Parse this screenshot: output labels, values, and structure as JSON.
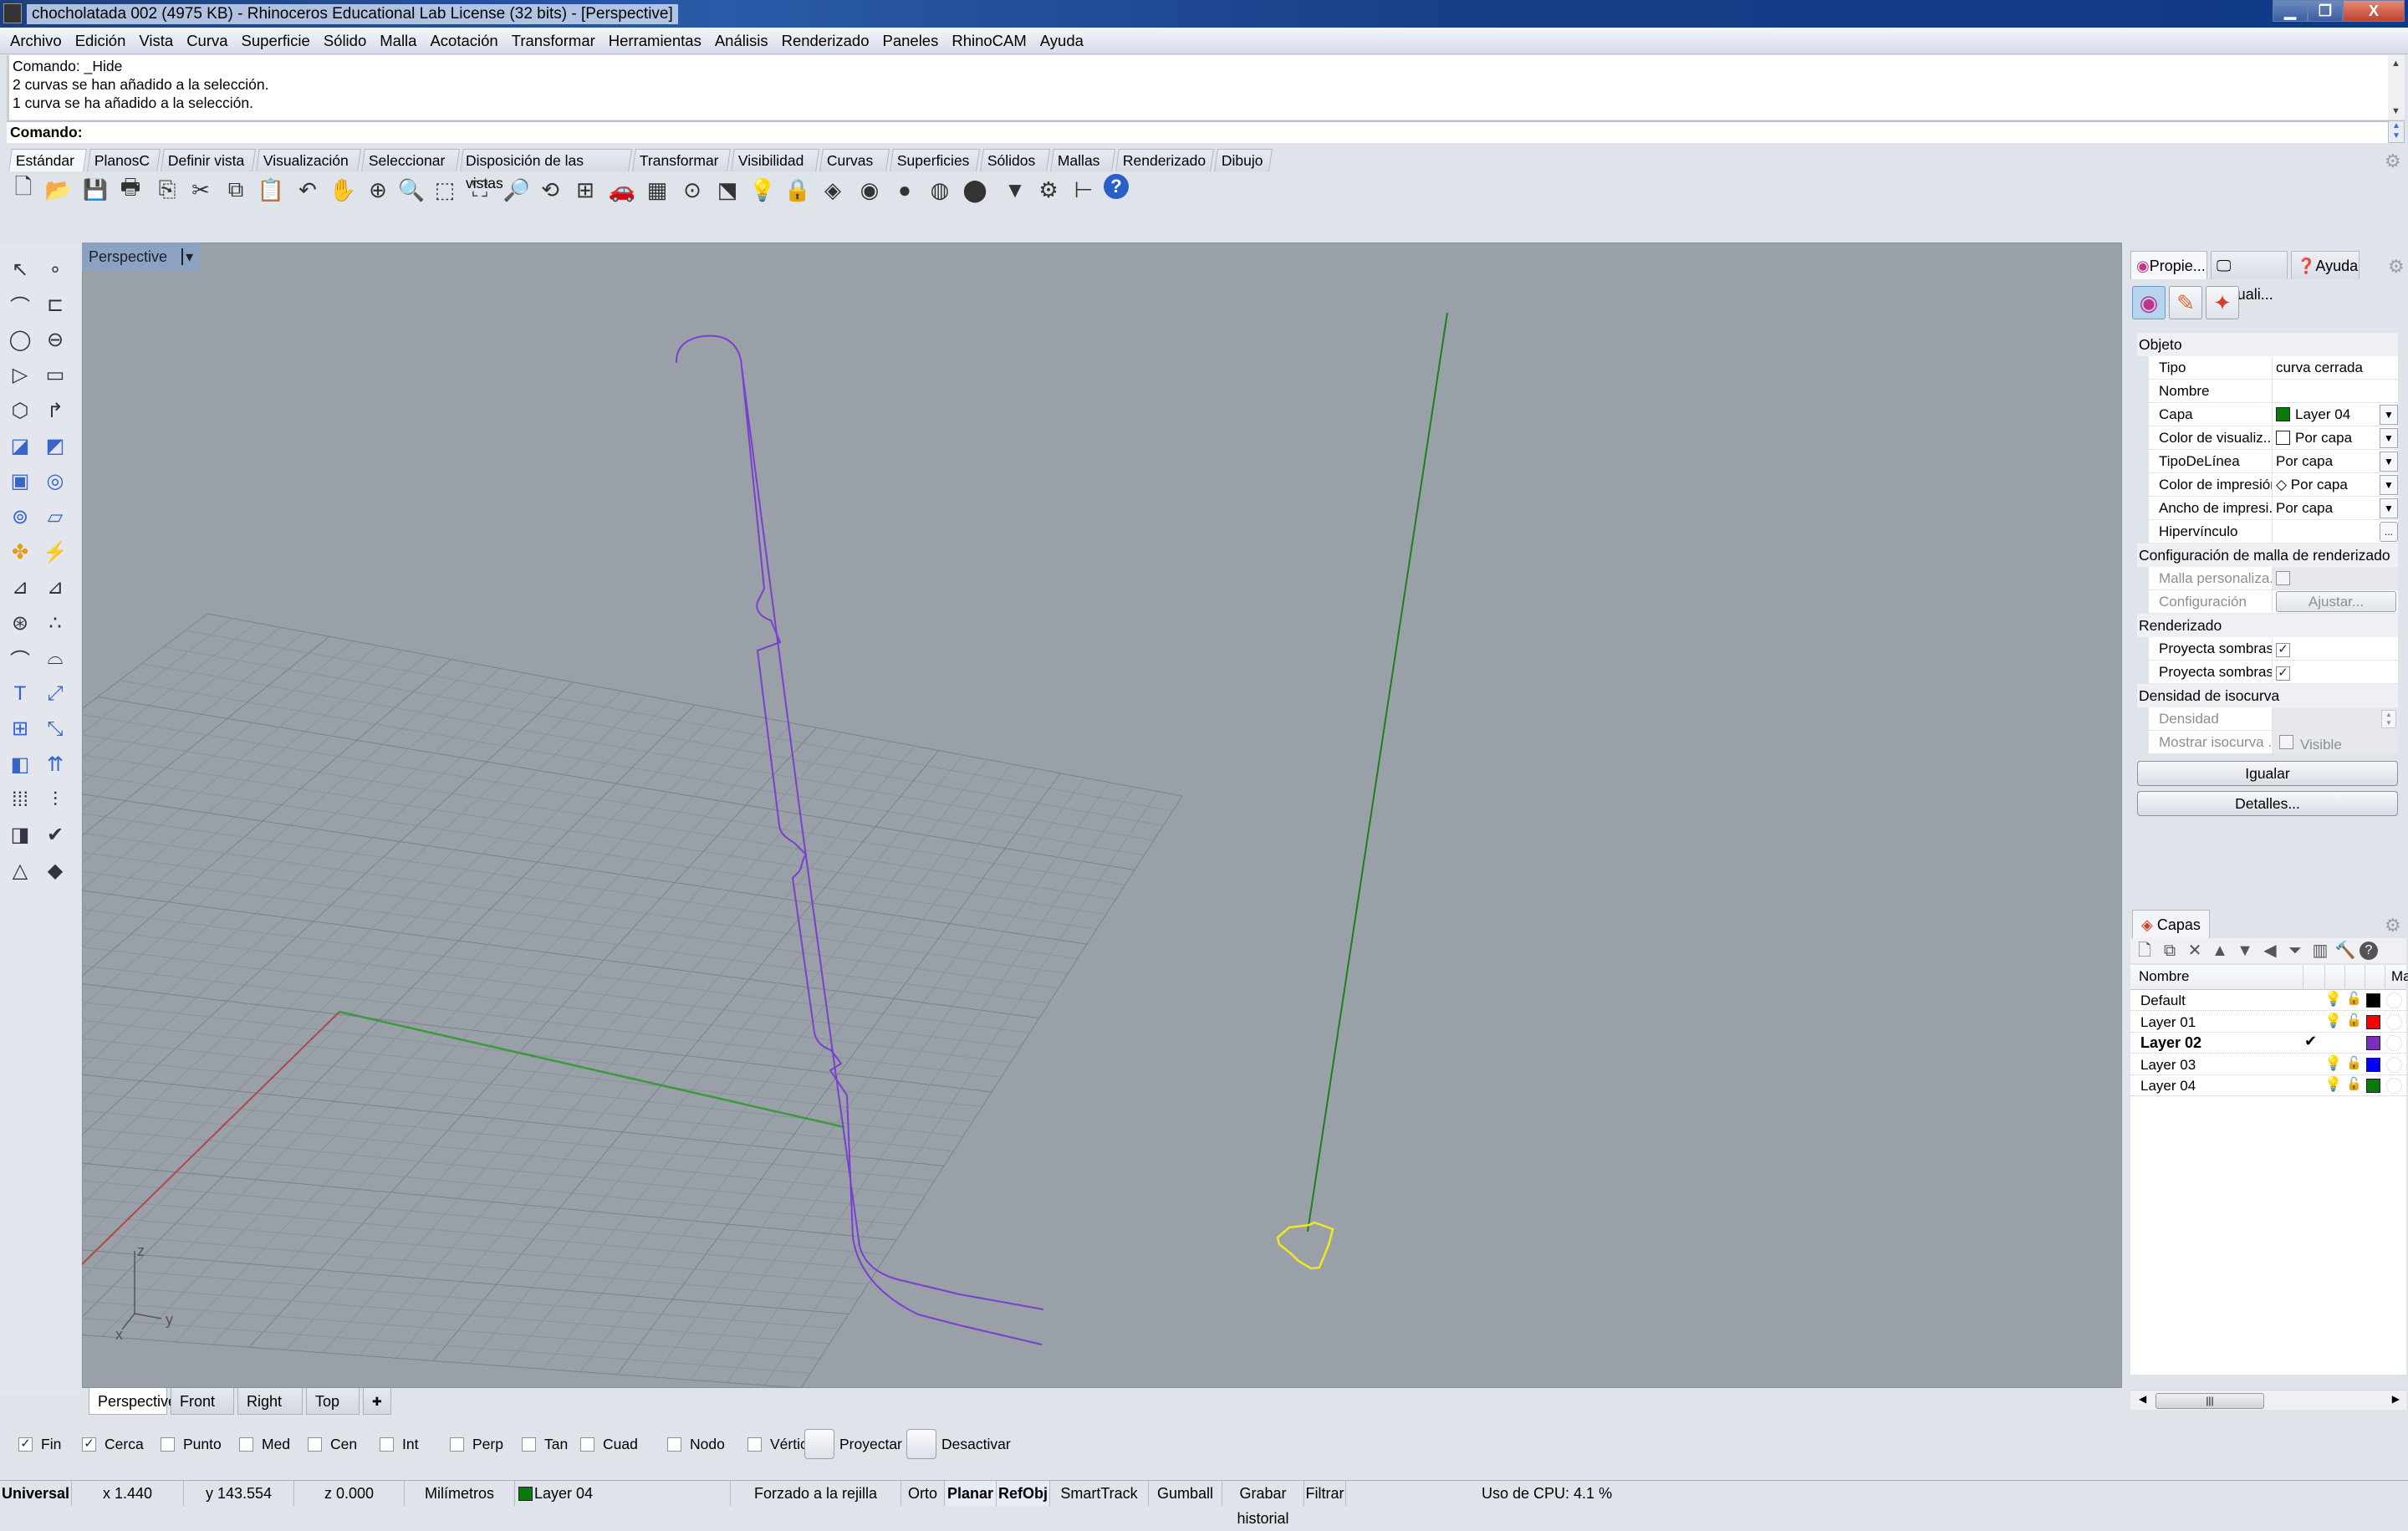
{
  "window": {
    "title": "chocholatada 002 (4975 KB) - Rhinoceros Educational Lab License (32 bits) - [Perspective]",
    "controls": {
      "minimize": "▁",
      "maximize": "❐",
      "close": "X"
    }
  },
  "menu": [
    "Archivo",
    "Edición",
    "Vista",
    "Curva",
    "Superficie",
    "Sólido",
    "Malla",
    "Acotación",
    "Transformar",
    "Herramientas",
    "Análisis",
    "Renderizado",
    "Paneles",
    "RhinoCAM",
    "Ayuda"
  ],
  "command": {
    "history": [
      "Comando: _Hide",
      "2 curvas se han añadido a la selección.",
      "1 curva se ha añadido a la selección."
    ],
    "prompt": "Comando:",
    "value": ""
  },
  "toolbar_tabs": [
    "Estándar",
    "PlanosC",
    "Definir vista",
    "Visualización",
    "Seleccionar",
    "Disposición de las vistas",
    "Transformar",
    "Visibilidad",
    "Curvas",
    "Superficies",
    "Sólidos",
    "Mallas",
    "Renderizado",
    "Dibujo"
  ],
  "toolbar_active_tab": "Estándar",
  "toolbar_icons": [
    {
      "name": "new-file-icon",
      "glyph": "🗋"
    },
    {
      "name": "open-folder-icon",
      "glyph": "📂"
    },
    {
      "name": "save-icon",
      "glyph": "💾"
    },
    {
      "name": "print-icon",
      "glyph": "🖶"
    },
    {
      "name": "export-icon",
      "glyph": "⎘"
    },
    {
      "name": "cut-icon",
      "glyph": "✂"
    },
    {
      "name": "copy-icon",
      "glyph": "⧉"
    },
    {
      "name": "paste-icon",
      "glyph": "📋"
    },
    {
      "name": "undo-icon",
      "glyph": "↶"
    },
    {
      "name": "pan-hand-icon",
      "glyph": "✋"
    },
    {
      "name": "rotate-view-icon",
      "glyph": "⊕"
    },
    {
      "name": "zoom-dynamic-icon",
      "glyph": "🔍"
    },
    {
      "name": "zoom-window-icon",
      "glyph": "⬚"
    },
    {
      "name": "zoom-extents-icon",
      "glyph": "⛶"
    },
    {
      "name": "zoom-selected-icon",
      "glyph": "🔎"
    },
    {
      "name": "undo-view-icon",
      "glyph": "⟲"
    },
    {
      "name": "four-viewports-icon",
      "glyph": "⊞"
    },
    {
      "name": "car-shaded-icon",
      "glyph": "🚗"
    },
    {
      "name": "grid-snap-icon",
      "glyph": "▦"
    },
    {
      "name": "point-on-icon",
      "glyph": "⊙"
    },
    {
      "name": "select-filter-icon",
      "glyph": "⬔"
    },
    {
      "name": "light-bulb-icon",
      "glyph": "💡"
    },
    {
      "name": "lock-icon",
      "glyph": "🔒"
    },
    {
      "name": "layers-icon",
      "glyph": "◈"
    },
    {
      "name": "color-wheel-icon",
      "glyph": "◉"
    },
    {
      "name": "sphere-wire-icon",
      "glyph": "●"
    },
    {
      "name": "sphere-shaded-icon",
      "glyph": "◍"
    },
    {
      "name": "sphere-render-icon",
      "glyph": "⬤"
    },
    {
      "name": "material-cone-icon",
      "glyph": "▼"
    },
    {
      "name": "options-gear-icon",
      "glyph": "⚙"
    },
    {
      "name": "dimension-icon",
      "glyph": "⊢"
    },
    {
      "name": "help-icon",
      "glyph": "?"
    }
  ],
  "left_toolbar_icons": [
    [
      "select-arrow-icon",
      "point-icon"
    ],
    [
      "polyline-icon",
      "curve-cv-icon"
    ],
    [
      "circle-icon",
      "ellipse-icon"
    ],
    [
      "polygon-icon",
      "rectangle-icon"
    ],
    [
      "polygon-center-icon",
      "fillet-curve-icon"
    ],
    [
      "surface-corner-icon",
      "extrude-surface-icon"
    ],
    [
      "box-icon",
      "sphere-icon"
    ],
    [
      "revolve-icon",
      "network-surface-icon"
    ],
    [
      "boolean-union-icon",
      "explode-icon"
    ],
    [
      "trim-icon",
      "split-icon"
    ],
    [
      "group-icon",
      "ungroup-icon"
    ],
    [
      "offset-curve-icon",
      "offset-curve-dashed-icon"
    ],
    [
      "text-icon",
      "move-icon"
    ],
    [
      "array-icon",
      "scale-icon"
    ],
    [
      "solid-edit-icon",
      "extrude-up-icon"
    ],
    [
      "grid-array-icon",
      "mirror-icon"
    ],
    [
      "boolean-diff-icon",
      "check-icon"
    ],
    [
      "primitive-solids-icon",
      "pyramid-icon"
    ]
  ],
  "left_toolbar_glyphs": [
    [
      "↖",
      "∘"
    ],
    [
      "⌒",
      "⊏"
    ],
    [
      "◯",
      "⊖"
    ],
    [
      "▷",
      "▭"
    ],
    [
      "⬡",
      "↱"
    ],
    [
      "◪",
      "◩"
    ],
    [
      "▣",
      "◎"
    ],
    [
      "⊚",
      "▱"
    ],
    [
      "✤",
      "⚡"
    ],
    [
      "⊿",
      "⊿"
    ],
    [
      "⊛",
      "∴"
    ],
    [
      "⌒",
      "⌓"
    ],
    [
      "T",
      "⤢"
    ],
    [
      "⊞",
      "⤡"
    ],
    [
      "◧",
      "⇈"
    ],
    [
      "⁞⁞⁞",
      "⫶"
    ],
    [
      "◨",
      "✔"
    ],
    [
      "△",
      "◆"
    ]
  ],
  "viewport": {
    "name": "Perspective",
    "dropdown": "▾",
    "axis_labels": {
      "z": "z",
      "y": "y",
      "x": "x"
    },
    "colors": {
      "background": "#9aa0a8",
      "grid": "#8a9098",
      "x_axis": "#b04848",
      "y_axis": "#3c9a3c",
      "curve_layer02": "#7b3fd0",
      "line_layer04": "#1f7d1f",
      "selected_curve": "#f0e820"
    }
  },
  "view_tabs": [
    "Perspective",
    "Front",
    "Right",
    "Top"
  ],
  "view_tab_add": "✚",
  "osnaps": [
    {
      "label": "Fin",
      "checked": true
    },
    {
      "label": "Cerca",
      "checked": true
    },
    {
      "label": "Punto",
      "checked": false
    },
    {
      "label": "Med",
      "checked": false
    },
    {
      "label": "Cen",
      "checked": false
    },
    {
      "label": "Int",
      "checked": false
    },
    {
      "label": "Perp",
      "checked": false
    },
    {
      "label": "Tan",
      "checked": false
    },
    {
      "label": "Cuad",
      "checked": false
    },
    {
      "label": "Nodo",
      "checked": false
    },
    {
      "label": "Vértice",
      "checked": false
    }
  ],
  "osnap_buttons": [
    "Proyectar",
    "Desactivar"
  ],
  "status": {
    "cplane": "Universal",
    "x": "x 1.440",
    "y": "y 143.554",
    "z": "z 0.000",
    "units": "Milímetros",
    "layer": "Layer 04",
    "layer_color": "#0a7a0a",
    "toggles": [
      {
        "label": "Forzado a la rejilla",
        "on": false
      },
      {
        "label": "Orto",
        "on": false
      },
      {
        "label": "Planar",
        "on": true
      },
      {
        "label": "RefObj",
        "on": true
      },
      {
        "label": "SmartTrack",
        "on": false
      },
      {
        "label": "Gumball",
        "on": false
      },
      {
        "label": "Grabar historial",
        "on": false
      },
      {
        "label": "Filtrar",
        "on": false
      }
    ],
    "cpu": "Uso de CPU: 4.1 %"
  },
  "properties_panel": {
    "tabs": [
      "Propie...",
      "Visuali...",
      "Ayuda"
    ],
    "active_tab": "Propie...",
    "sections": {
      "object": "Objeto",
      "render_mesh": "Configuración de malla de renderizado",
      "rendering": "Renderizado",
      "isocurve": "Densidad de isocurva"
    },
    "object_rows": [
      {
        "key": "Tipo",
        "value": "curva cerrada",
        "dropdown": false
      },
      {
        "key": "Nombre",
        "value": "",
        "dropdown": false
      },
      {
        "key": "Capa",
        "value": "Layer 04",
        "swatch": "#0a7a0a",
        "dropdown": true
      },
      {
        "key": "Color de visualiz...",
        "value": "Por capa",
        "swatch": "#ffffff",
        "dropdown": true
      },
      {
        "key": "TipoDeLínea",
        "value": "Por capa",
        "dropdown": true
      },
      {
        "key": "Color de impresión",
        "value": "◇ Por capa",
        "dropdown": true
      },
      {
        "key": "Ancho de impresi...",
        "value": "Por capa",
        "dropdown": true
      },
      {
        "key": "Hipervínculo",
        "value": "",
        "button": "..."
      }
    ],
    "mesh_rows": [
      {
        "key": "Malla personaliza...",
        "checked": false
      },
      {
        "key": "Configuración",
        "button": "Ajustar..."
      }
    ],
    "render_rows": [
      {
        "key": "Proyecta sombras",
        "checked": true
      },
      {
        "key": "Proyecta sombras",
        "checked": true
      }
    ],
    "iso_rows": [
      {
        "key": "Densidad",
        "value": ""
      },
      {
        "key": "Mostrar isocurva ...",
        "value": "Visible",
        "checked": false
      }
    ],
    "buttons": [
      "Igualar",
      "Detalles..."
    ]
  },
  "layers_panel": {
    "tab": "Capas",
    "columns": [
      "Nombre",
      "Ma"
    ],
    "toolbar_icons": [
      "new-layer-icon",
      "new-sublayer-icon",
      "delete-icon",
      "move-up-icon",
      "move-down-icon",
      "move-left-icon",
      "filter-icon",
      "layer-state-icon",
      "tools-icon",
      "help-icon"
    ],
    "toolbar_glyphs": [
      "🗋",
      "⧉",
      "✕",
      "▲",
      "▼",
      "◀",
      "⏷",
      "▥",
      "🔨",
      "?"
    ],
    "layers": [
      {
        "name": "Default",
        "current": false,
        "visible": true,
        "unlocked": true,
        "color": "#000000"
      },
      {
        "name": "Layer 01",
        "current": false,
        "visible": true,
        "unlocked": true,
        "color": "#ff0000"
      },
      {
        "name": "Layer 02",
        "current": true,
        "visible": true,
        "unlocked": true,
        "color": "#7b2fbf"
      },
      {
        "name": "Layer 03",
        "current": false,
        "visible": true,
        "unlocked": true,
        "color": "#0000ff"
      },
      {
        "name": "Layer 04",
        "current": false,
        "visible": true,
        "unlocked": true,
        "color": "#0a7a0a"
      }
    ],
    "scroll_thumb": "|||"
  }
}
